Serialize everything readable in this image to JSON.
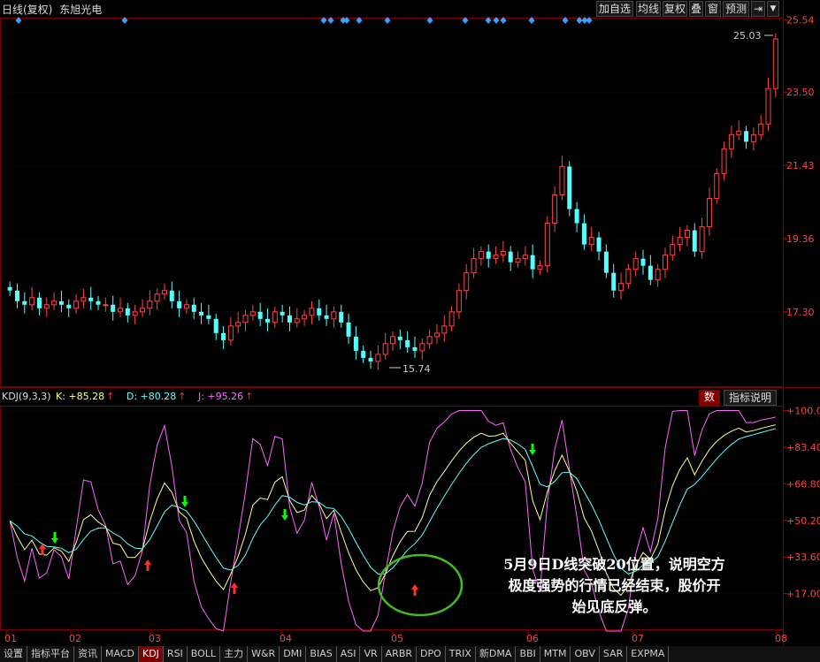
{
  "header": {
    "title": "日线(复权)",
    "stock_name": "东旭光电",
    "buttons": [
      "加自选",
      "均线",
      "复权",
      "叠",
      "窗",
      "预测"
    ],
    "nav_arrow": "⇥",
    "dropdown": "▼"
  },
  "price_axis": {
    "labels": [
      "25.54",
      "23.50",
      "21.43",
      "19.36",
      "17.30"
    ],
    "values": [
      25.54,
      23.5,
      21.43,
      19.36,
      17.3
    ],
    "range": [
      15.2,
      25.6
    ],
    "high_label": "25.03",
    "low_label": "15.74"
  },
  "kdj": {
    "name": "KDJ(9,3,3)",
    "k_label": "K: +85.28",
    "d_label": "D: +80.28",
    "j_label": "J: +95.26",
    "arrow": "↑",
    "buttons": [
      "数",
      "指标说明"
    ],
    "axis_labels": [
      "+100.0",
      "+83.40",
      "+66.80",
      "+50.20",
      "+33.60",
      "+17.00"
    ],
    "axis_values": [
      100,
      83.4,
      66.8,
      50.2,
      33.6,
      17.0
    ],
    "colors": {
      "k": "#ffff99",
      "d": "#66ffff",
      "j": "#ff66ff",
      "up": "#ff3030",
      "down": "#00ff00"
    }
  },
  "x_axis": {
    "months": [
      "01",
      "02",
      "03",
      "04",
      "05",
      "06",
      "07",
      "08"
    ]
  },
  "annotation": {
    "line1": "5月9日D线突破20位置，说明空方",
    "line2": "极度强势的行情已经结束，股价开",
    "line3": "始见底反弹。"
  },
  "tabs": {
    "items": [
      "设置",
      "指标平台",
      "资讯",
      "MACD",
      "KDJ",
      "RSI",
      "BOLL",
      "主力",
      "W&R",
      "DMI",
      "BIAS",
      "ASI",
      "VR",
      "ARBR",
      "DPO",
      "TRIX",
      "新DMA",
      "BBI",
      "MTM",
      "OBV",
      "SAR",
      "EXPMA"
    ],
    "active": "KDJ"
  },
  "chart_data": {
    "type": "candlestick",
    "price_series": [
      17.9,
      17.6,
      17.5,
      17.7,
      17.4,
      17.5,
      17.6,
      17.5,
      17.4,
      17.6,
      17.7,
      17.6,
      17.5,
      17.5,
      17.3,
      17.4,
      17.2,
      17.3,
      17.4,
      17.6,
      17.8,
      17.9,
      17.6,
      17.4,
      17.5,
      17.3,
      17.2,
      17.1,
      16.7,
      16.5,
      16.9,
      17.0,
      17.2,
      17.3,
      17.1,
      17.0,
      17.3,
      17.2,
      17.0,
      17.1,
      17.2,
      17.4,
      17.2,
      17.1,
      17.3,
      17.0,
      16.6,
      16.2,
      16.0,
      15.9,
      16.1,
      16.4,
      16.6,
      16.5,
      16.3,
      16.2,
      16.4,
      16.6,
      16.7,
      16.9,
      17.3,
      17.9,
      18.4,
      18.8,
      19.0,
      18.8,
      18.9,
      19.0,
      18.7,
      18.8,
      18.9,
      18.5,
      18.6,
      19.8,
      20.6,
      21.4,
      20.2,
      19.8,
      19.2,
      19.4,
      19.0,
      18.4,
      17.9,
      18.1,
      18.5,
      18.8,
      18.6,
      18.2,
      18.5,
      18.9,
      19.2,
      19.4,
      19.6,
      19.0,
      19.7,
      20.5,
      21.2,
      21.9,
      22.3,
      22.4,
      22.1,
      22.3,
      22.6,
      23.6,
      25.0
    ],
    "events": [
      {
        "type": "ma_cross_up",
        "date_month": "05",
        "note": "D line crosses 20"
      }
    ]
  }
}
